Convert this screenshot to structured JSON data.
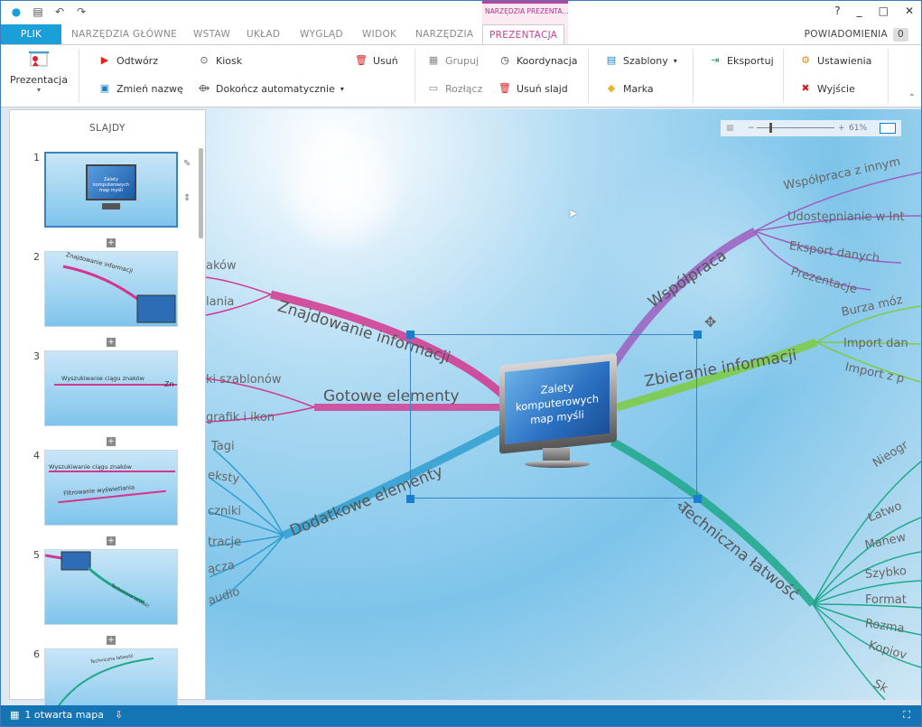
{
  "titlebar": {
    "help": "?",
    "minimize": "_",
    "maximize": "□",
    "close": "✕"
  },
  "context_group": "NARZĘDZIA PREZENTA...",
  "tabs": [
    {
      "label": "PLIK"
    },
    {
      "label": "NARZĘDZIA GŁÓWNE"
    },
    {
      "label": "WSTAW"
    },
    {
      "label": "UKŁAD"
    },
    {
      "label": "WYGLĄD"
    },
    {
      "label": "WIDOK"
    },
    {
      "label": "NARZĘDZIA"
    },
    {
      "label": "PREZENTACJA"
    }
  ],
  "notifications": {
    "label": "POWIADOMIENIA",
    "count": "0"
  },
  "ribbon": {
    "prezentacja": "Prezentacja",
    "odtworz": "Odtwórz",
    "zmien_nazwe": "Zmień nazwę",
    "kiosk": "Kiosk",
    "dokoncz": "Dokończ automatycznie",
    "usun": "Usuń",
    "grupuj": "Grupuj",
    "rozlacz": "Rozłącz",
    "koordynacja": "Koordynacja",
    "usun_slajd": "Usuń slajd",
    "szablony": "Szablony",
    "marka": "Marka",
    "eksportuj": "Eksportuj",
    "ustawienia": "Ustawienia",
    "wyjscie": "Wyjście"
  },
  "slides": {
    "title": "SLAJDY",
    "items": [
      {
        "num": "1",
        "text": "Zalety komputerowych map myśli"
      },
      {
        "num": "2",
        "text": "Znajdowanie informacji"
      },
      {
        "num": "3",
        "text": "Wyszukiwanie ciągu znaków"
      },
      {
        "num": "4",
        "text": "Wyszukiwanie ciągu znaków",
        "text2": "Filtrowanie wyświetlania"
      },
      {
        "num": "5",
        "text": "Techniczna łatwość"
      },
      {
        "num": "6",
        "text": "Techniczna łatwość"
      }
    ]
  },
  "zoom": {
    "value": "61%"
  },
  "map": {
    "center": "Zalety komputerowych map myśli",
    "branches": {
      "znajdowanie": "Znajdowanie informacji",
      "gotowe": "Gotowe elementy",
      "dodatkowe": "Dodatkowe elementy",
      "wspolpraca": "Współpraca",
      "zbieranie": "Zbieranie informacji",
      "techniczna": "Techniczna łatwość"
    },
    "left_leaves": [
      "aków",
      "lania",
      "ki szablonów",
      "grafik i ikon",
      "Tagi",
      "eksty",
      "czniki",
      "tracje",
      "ącza",
      "audio"
    ],
    "wsp_leaves": [
      "Współpraca z innym",
      "Udostępnianie w Int",
      "Eksport danych",
      "Prezentacje"
    ],
    "zb_leaves": [
      "Burza móz",
      "Import dan",
      "Import z p"
    ],
    "tech_leaves": [
      "Nieogr",
      "Łatwo",
      "Manew",
      "Szybko",
      "Format",
      "Rozma",
      "Kopiov",
      "Sk"
    ]
  },
  "colors": {
    "pink": "#d4368f",
    "blue": "#2f9fd0",
    "purple": "#9b5fc0",
    "green": "#7ecb3f",
    "teal": "#1fa88a",
    "accent": "#1574b3"
  },
  "status": {
    "maps": "1 otwarta mapa"
  }
}
